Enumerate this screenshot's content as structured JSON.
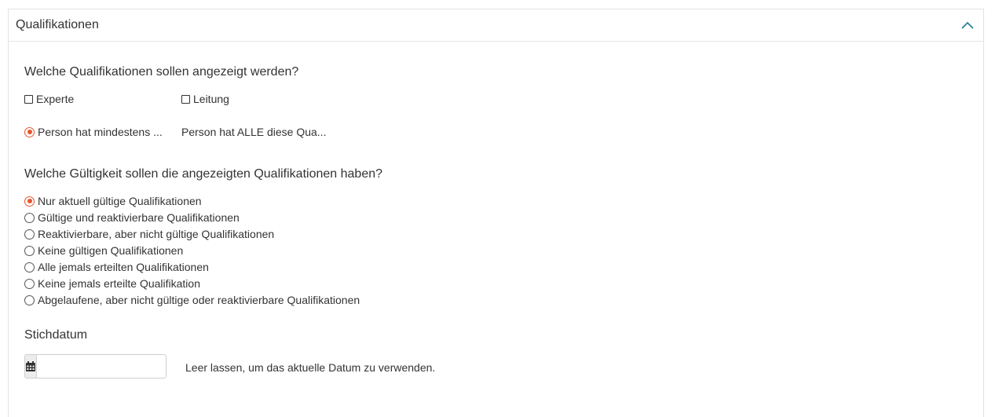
{
  "panel": {
    "title": "Qualifikationen"
  },
  "qualifications": {
    "question": "Welche Qualifikationen sollen angezeigt werden?",
    "checkboxes": [
      {
        "label": "Experte",
        "checked": false
      },
      {
        "label": "Leitung",
        "checked": false
      }
    ],
    "match_mode": [
      {
        "label": "Person hat mindestens ...",
        "selected": true
      },
      {
        "label": "Person hat ALLE diese Qua...",
        "selected": false
      }
    ]
  },
  "validity": {
    "question": "Welche Gültigkeit sollen die angezeigten Qualifikationen haben?",
    "options": [
      {
        "label": "Nur aktuell gültige Qualifikationen",
        "selected": true
      },
      {
        "label": "Gültige und reaktivierbare Qualifikationen",
        "selected": false
      },
      {
        "label": "Reaktivierbare, aber nicht gültige Qualifikationen",
        "selected": false
      },
      {
        "label": "Keine gültigen Qualifikationen",
        "selected": false
      },
      {
        "label": "Alle jemals erteilten Qualifikationen",
        "selected": false
      },
      {
        "label": "Keine jemals erteilte Qualifikation",
        "selected": false
      },
      {
        "label": "Abgelaufene, aber nicht gültige oder reaktivierbare Qualifikationen",
        "selected": false
      }
    ]
  },
  "reference_date": {
    "label": "Stichdatum",
    "value": "",
    "hint": "Leer lassen, um das aktuelle Datum zu verwenden.",
    "icon": "calendar-icon"
  },
  "colors": {
    "accent": "#e4572e",
    "chevron": "#1f7a8c"
  }
}
